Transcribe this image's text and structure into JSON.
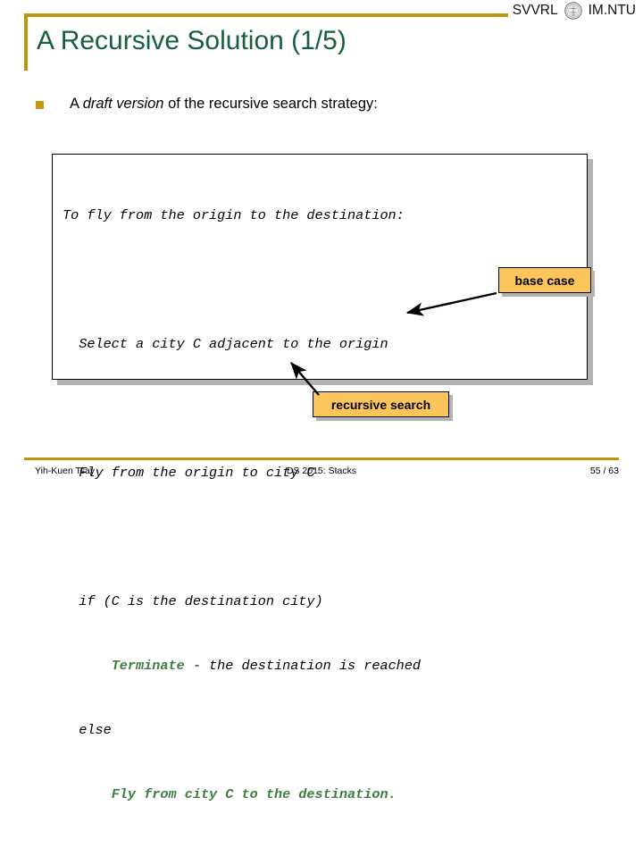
{
  "header": {
    "title": "A Recursive Solution (1/5)",
    "brand_left": "SVVRL",
    "brand_right": "IM.NTU",
    "seal_icon": "ntu-seal-icon",
    "rule_color": "#bf9510",
    "title_color": "#16603c"
  },
  "body": {
    "bullet_icon": "bullet-square-icon",
    "bullet_prefix": "A ",
    "bullet_emphasis": "draft version",
    "bullet_suffix": " of the recursive search strategy:"
  },
  "code": {
    "lines": [
      {
        "text": "To fly from the origin to the destination:",
        "indent": 0
      },
      {
        "text": "",
        "indent": 0
      },
      {
        "text": "  Select a city C adjacent to the origin",
        "indent": 0
      },
      {
        "text": "",
        "indent": 0
      },
      {
        "text": "  Fly from the origin to city C",
        "indent": 0
      },
      {
        "text": "",
        "indent": 0
      },
      {
        "text": "  if (C is the destination city)",
        "indent": 0
      },
      {
        "text": "      Terminate - the destination is reached",
        "indent": 0
      },
      {
        "text": "  else",
        "indent": 0
      },
      {
        "text": "      Fly from city C to the destination.",
        "indent": 0
      }
    ],
    "line1": "To fly from the origin to the destination:",
    "line3": "  Select a city C adjacent to the origin",
    "line5": "  Fly from the origin to city C",
    "line7": "  if (C is the destination city)",
    "line8_indent": "      ",
    "line8_keyword": "Terminate",
    "line8_rest": " - the destination is reached",
    "line9": "  else",
    "line10_indent": "      ",
    "line10_green": "Fly from city C to the destination.",
    "green_color": "#3e7d3e"
  },
  "callouts": {
    "base_case": "base case",
    "recursive_search": "recursive search",
    "fill_color": "#fcc55c"
  },
  "footer": {
    "author": "Yih-Kuen Tsay",
    "course": "DS 2015: Stacks",
    "page": "55 / 63"
  }
}
